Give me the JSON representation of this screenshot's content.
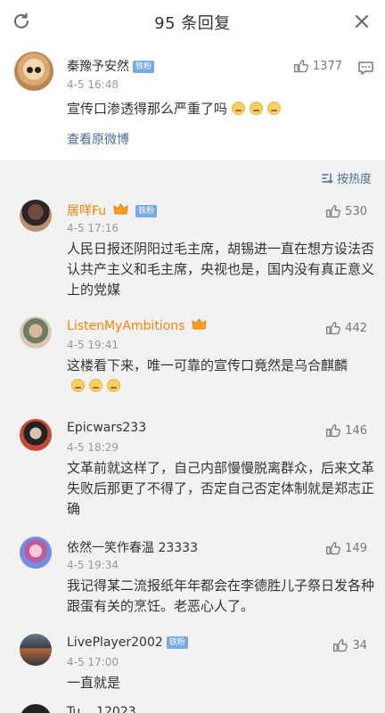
{
  "header": {
    "title": "95 条回复"
  },
  "main_post": {
    "user": "秦豫予安然",
    "fan_badge": "铁粉",
    "time": "4-5 16:48",
    "likes": "1377",
    "text": "宣传口渗透得那么严重了吗",
    "view_original": "查看原微博"
  },
  "sort": {
    "label": "按热度"
  },
  "comments": [
    {
      "user": "居咩Fu",
      "fan_badge": "铁粉",
      "time": "4-5 17:16",
      "likes": "530",
      "text": "人民日报还阴阳过毛主席，胡锡进一直在想方设法否认共产主义和毛主席，央视也是，国内没有真正意义上的党媒"
    },
    {
      "user": "ListenMyAmbitions",
      "time": "4-5 19:41",
      "likes": "442",
      "text": "这楼看下来，唯一可靠的宣传口竟然是乌合麒麟"
    },
    {
      "user": "Epicwars233",
      "time": "4-5 18:29",
      "likes": "146",
      "text": "文革前就这样了，自己内部慢慢脱离群众，后来文革失败后那更了不得了，否定自己否定体制就是郑志正确"
    },
    {
      "user": "依然一笑作春温 23333",
      "time": "4-5 19:34",
      "likes": "149",
      "text": "我记得某二流报纸年年都会在李德胜儿子祭日发各种跟蛋有关的烹饪。老恶心人了。"
    },
    {
      "user": "LivePlayer2002",
      "fan_badge": "铁粉",
      "time": "4-5 17:00",
      "likes": "34",
      "text": "一直就是"
    }
  ],
  "partial_comment": {
    "user": "Tu... 12023"
  }
}
